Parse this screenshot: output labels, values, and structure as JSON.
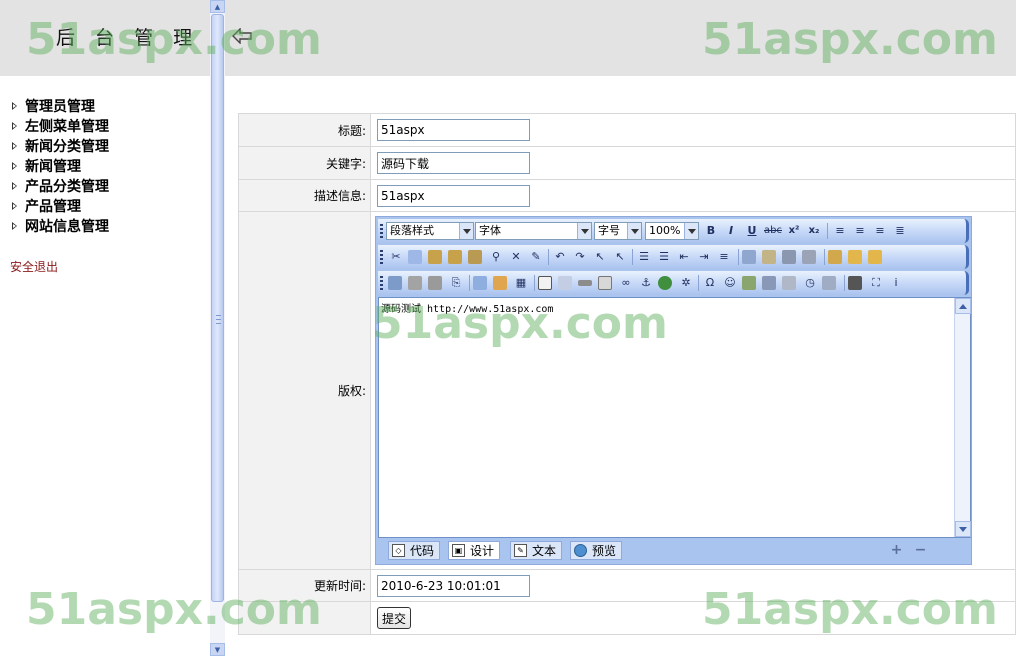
{
  "sidebar": {
    "title": "后 台 管 理",
    "items": [
      {
        "label": "管理员管理"
      },
      {
        "label": "左侧菜单管理"
      },
      {
        "label": "新闻分类管理"
      },
      {
        "label": "新闻管理"
      },
      {
        "label": "产品分类管理"
      },
      {
        "label": "产品管理"
      },
      {
        "label": "网站信息管理"
      }
    ],
    "logout_label": "安全退出"
  },
  "form": {
    "title": {
      "label": "标题:",
      "value": "51aspx"
    },
    "keywords": {
      "label": "关键字:",
      "value": "源码下载"
    },
    "description": {
      "label": "描述信息:",
      "value": "51aspx"
    },
    "copyright": {
      "label": "版权:"
    },
    "update_time": {
      "label": "更新时间:",
      "value": "2010-6-23 10:01:01"
    },
    "submit_label": "提交"
  },
  "editor": {
    "paragraph_style": "段落样式",
    "font": "字体",
    "font_size": "字号",
    "zoom": "100%",
    "bold": "B",
    "italic": "I",
    "underline": "U",
    "strike": "abc",
    "superscript": "x²",
    "subscript": "x₂",
    "content": "源码测试 http://www.51aspx.com",
    "modes": [
      {
        "label": "代码",
        "icon": "code-icon"
      },
      {
        "label": "设计",
        "icon": "design-icon"
      },
      {
        "label": "文本",
        "icon": "text-icon"
      },
      {
        "label": "预览",
        "icon": "preview-icon"
      }
    ],
    "active_mode": "设计"
  },
  "watermark": "51aspx.com",
  "colors": {
    "header_bg": "#e3e3e3",
    "label_bg": "#f2f2f2",
    "logout": "#8b1a1a",
    "editor_frame": "#a9c4ee",
    "watermark": "#5faf5f"
  }
}
